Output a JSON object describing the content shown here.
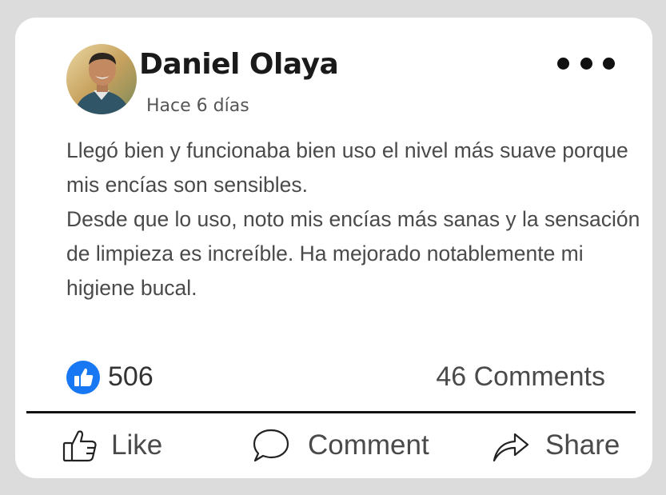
{
  "post": {
    "author_name": "Daniel Olaya",
    "timestamp": "Hace 6 días",
    "body_paragraphs": [
      "Llegó bien y funcionaba bien uso el nivel más suave porque mis encías son sensibles.",
      "Desde que lo uso, noto mis encías más sanas y la sensación de limpieza es increíble. Ha mejorado notablemente mi higiene bucal."
    ]
  },
  "reactions": {
    "like_count": "506",
    "comments_label": "46 Comments",
    "like_icon": "thumbs-up-badge-icon"
  },
  "actions": {
    "like_label": "Like",
    "comment_label": "Comment",
    "share_label": "Share"
  },
  "icons": {
    "menu": "more-dots-icon",
    "like": "thumbs-up-icon",
    "comment": "speech-bubble-icon",
    "share": "share-arrow-icon"
  },
  "colors": {
    "like_badge": "#1877f2",
    "text": "#4a4a4a",
    "author": "#1a1a1a"
  }
}
